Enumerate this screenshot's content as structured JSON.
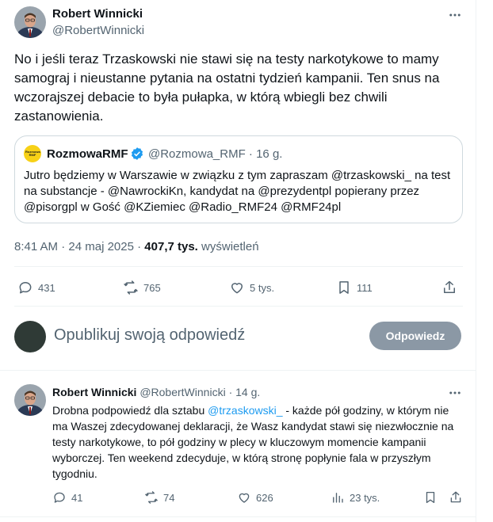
{
  "main_tweet": {
    "author_name": "Robert Winnicki",
    "author_handle": "@RobertWinnicki",
    "text": "No i jeśli teraz Trzaskowski nie stawi się na testy narkotykowe to mamy samograj i nieustanne pytania na ostatni tydzień kampanii. Ten snus na wczorajszej debacie to była pułapka, w którą wbiegli bez chwili zastanowienia.",
    "quote": {
      "author_name": "RozmowaRMF",
      "author_handle": "@Rozmowa_RMF",
      "separator": "·",
      "time": "16 g.",
      "avatar_text": "Rozmowa RMF",
      "text": "Jutro będziemy w Warszawie w związku z tym zapraszam @trzaskowski_ na test na substancje - @NawrockiKn, kandydat na @prezydentpl popierany przez @pisorgpl w Gość @KZiemiec @Radio_RMF24 @RMF24pl"
    },
    "meta": {
      "time": "8:41 AM",
      "separator1": "·",
      "date": "24 maj 2025",
      "separator2": "·",
      "views_count": "407,7 tys.",
      "views_label": "wyświetleń"
    },
    "actions": {
      "replies": "431",
      "reposts": "765",
      "likes": "5 tys.",
      "bookmarks": "111"
    }
  },
  "reply_composer": {
    "placeholder": "Opublikuj swoją odpowiedź",
    "button_label": "Odpowiedz"
  },
  "reply_tweet": {
    "author_name": "Robert Winnicki",
    "author_handle": "@RobertWinnicki",
    "separator": "·",
    "time": "14 g.",
    "text_mention": "@trzaskowski_",
    "text_before": "Drobna podpowiedź dla sztabu ",
    "text_after": " - każde pół godziny, w którym nie ma Waszej zdecydowanej deklaracji, że Wasz kandydat stawi się niezwłocznie na testy narkotykowe, to pół godziny w plecy w kluczowym momencie kampanii wyborczej. Ten weekend zdecyduje, w którą stronę popłynie fala w przyszłym tygodniu.",
    "actions": {
      "replies": "41",
      "reposts": "74",
      "likes": "626",
      "views": "23 tys."
    }
  },
  "colors": {
    "accent": "#1d9bf0",
    "muted": "#536471",
    "button_bg": "#8b98a5",
    "rmf_yellow": "#f7d117"
  }
}
